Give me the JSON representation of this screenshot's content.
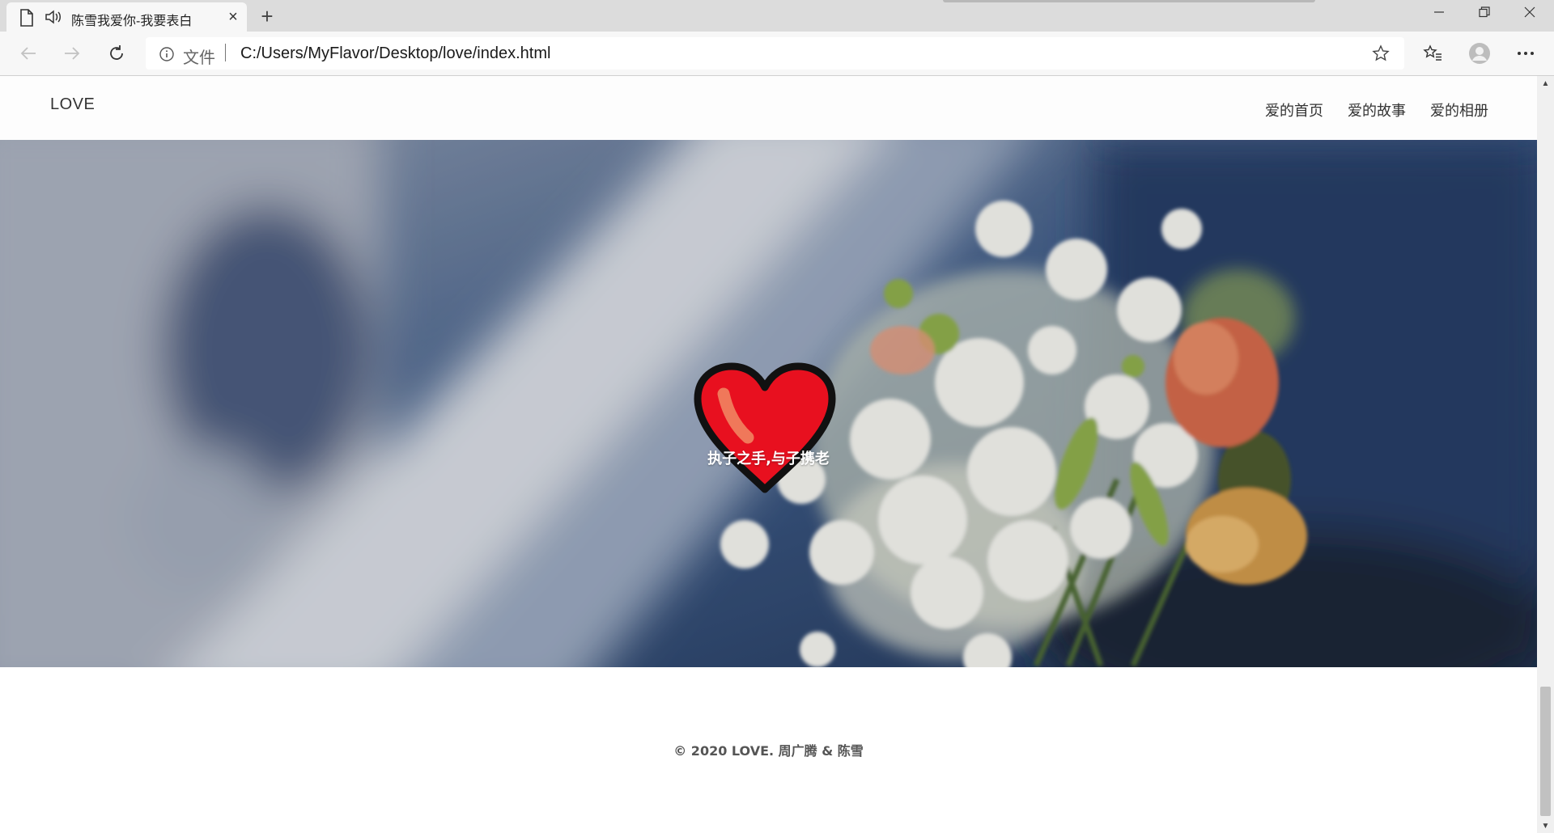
{
  "browser": {
    "tab_title": "陈雪我爱你-我要表白",
    "tab_close": "×",
    "new_tab": "+",
    "address_scheme": "文件",
    "address_url": "C:/Users/MyFlavor/Desktop/love/index.html"
  },
  "icons": {
    "page": "page-icon",
    "audio": "speaker-icon",
    "back": "back-arrow-icon",
    "forward": "forward-arrow-icon",
    "refresh": "refresh-icon",
    "info": "info-icon",
    "favorite": "star-icon",
    "favorites_list": "favorites-icon",
    "profile": "profile-avatar-icon",
    "more": "more-dots-icon",
    "heart": "heart-icon"
  },
  "site": {
    "logo": "LOVE",
    "menu": [
      {
        "label": "爱的首页"
      },
      {
        "label": "爱的故事"
      },
      {
        "label": "爱的相册"
      }
    ],
    "tagline": "执子之手,与子携老",
    "footer": "© 2020 LOVE. 周广腾 & 陈雪"
  },
  "colors": {
    "heart_fill": "#e8101f",
    "heart_outline": "#111111",
    "heart_highlight": "#f0785a",
    "hero_blue": "#2d4b7a"
  },
  "scroll": {
    "thumb_position": 0.83
  }
}
